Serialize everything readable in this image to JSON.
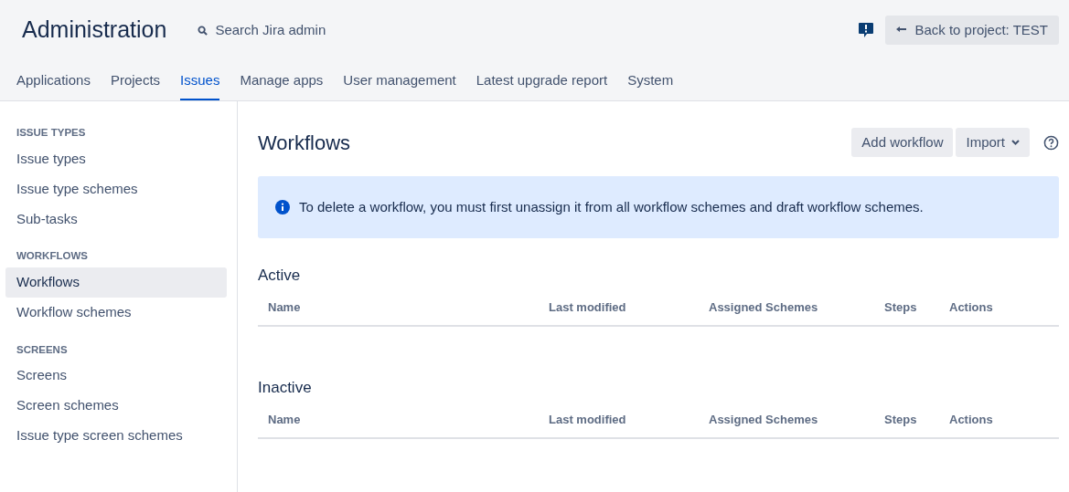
{
  "header": {
    "title": "Administration",
    "search": {
      "placeholder": "Search Jira admin"
    },
    "back_button": "Back to project: TEST"
  },
  "tabs": [
    {
      "label": "Applications",
      "selected": false
    },
    {
      "label": "Projects",
      "selected": false
    },
    {
      "label": "Issues",
      "selected": true
    },
    {
      "label": "Manage apps",
      "selected": false
    },
    {
      "label": "User management",
      "selected": false
    },
    {
      "label": "Latest upgrade report",
      "selected": false
    },
    {
      "label": "System",
      "selected": false
    }
  ],
  "sidebar": {
    "sections": [
      {
        "heading": "ISSUE TYPES",
        "items": [
          {
            "label": "Issue types",
            "selected": false
          },
          {
            "label": "Issue type schemes",
            "selected": false
          },
          {
            "label": "Sub-tasks",
            "selected": false
          }
        ]
      },
      {
        "heading": "WORKFLOWS",
        "items": [
          {
            "label": "Workflows",
            "selected": true
          },
          {
            "label": "Workflow schemes",
            "selected": false
          }
        ]
      },
      {
        "heading": "SCREENS",
        "items": [
          {
            "label": "Screens",
            "selected": false
          },
          {
            "label": "Screen schemes",
            "selected": false
          },
          {
            "label": "Issue type screen schemes",
            "selected": false
          }
        ]
      }
    ]
  },
  "page": {
    "title": "Workflows",
    "buttons": [
      {
        "label": "Add workflow",
        "kind": "plain"
      },
      {
        "label": "Import",
        "kind": "dropdown"
      }
    ],
    "info_message": "To delete a workflow, you must first unassign it from all workflow schemes and draft workflow schemes.",
    "tables": [
      {
        "title": "Active",
        "columns": [
          "Name",
          "Last modified",
          "Assigned Schemes",
          "Steps",
          "Actions"
        ]
      },
      {
        "title": "Inactive",
        "columns": [
          "Name",
          "Last modified",
          "Assigned Schemes",
          "Steps",
          "Actions"
        ]
      }
    ]
  }
}
